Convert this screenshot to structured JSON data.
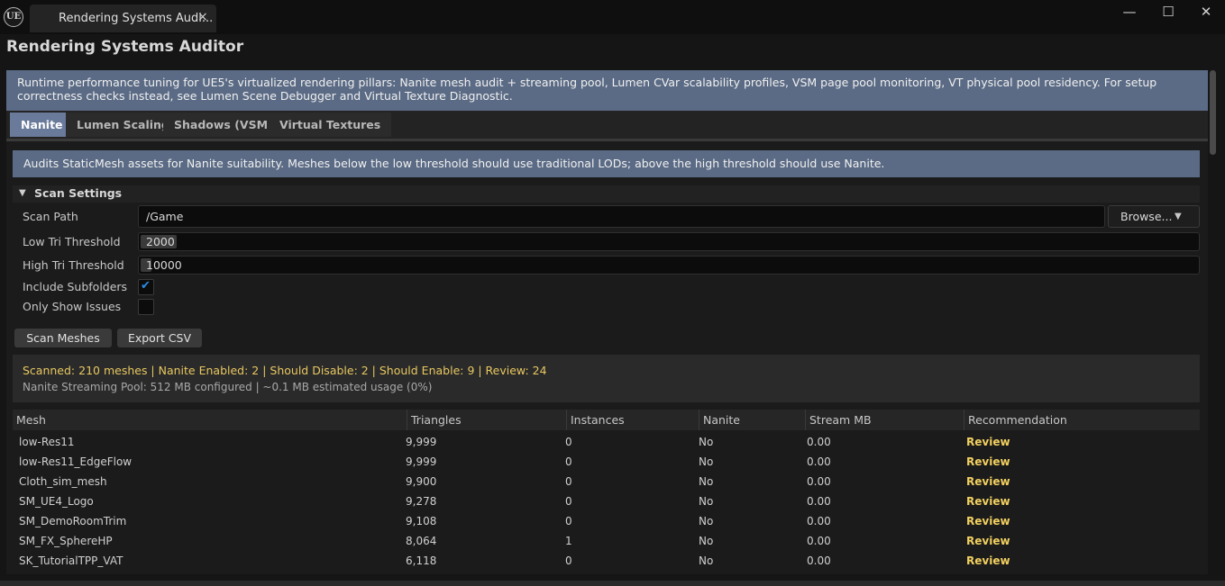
{
  "window": {
    "tab_title": "Rendering Systems Audi...",
    "logo_text": "UE",
    "close_tab_glyph": "×",
    "minimize_glyph": "—",
    "maximize_glyph": "☐",
    "close_glyph": "✕"
  },
  "app_title": "Rendering Systems Auditor",
  "intro_text": "Runtime performance tuning for UE5's virtualized rendering pillars: Nanite mesh audit + streaming pool, Lumen CVar scalability profiles, VSM page pool monitoring, VT physical pool residency. For setup correctness checks instead, see Lumen Scene Debugger and Virtual Texture Diagnostic.",
  "tabs": [
    {
      "label": "Nanite",
      "active": true
    },
    {
      "label": "Lumen Scaling",
      "active": false
    },
    {
      "label": "Shadows (VSM)",
      "active": false
    },
    {
      "label": "Virtual Textures",
      "active": false
    }
  ],
  "section_description": "Audits StaticMesh assets for Nanite suitability. Meshes below the low threshold should use traditional LODs; above the high threshold should use Nanite.",
  "scan_settings": {
    "title": "Scan Settings",
    "scan_path_label": "Scan Path",
    "scan_path_value": "/Game",
    "browse_label": "Browse...",
    "low_tri_label": "Low Tri Threshold",
    "low_tri_value": "2000",
    "high_tri_label": "High Tri Threshold",
    "high_tri_value": "10000",
    "include_subfolders_label": "Include Subfolders",
    "include_subfolders_checked": true,
    "only_issues_label": "Only Show Issues",
    "only_issues_checked": false
  },
  "actions": {
    "scan_label": "Scan Meshes",
    "export_label": "Export CSV"
  },
  "summary": {
    "line1": "Scanned: 210 meshes  |  Nanite Enabled: 2  |  Should Disable: 2  |  Should Enable: 9  |  Review: 24",
    "line2": "Nanite Streaming Pool: 512 MB configured  |  ~0.1 MB estimated usage (0%)"
  },
  "table": {
    "columns": [
      "Mesh",
      "Triangles",
      "Instances",
      "Nanite",
      "Stream MB",
      "Recommendation"
    ],
    "rows": [
      [
        "low-Res11",
        "9,999",
        "0",
        "No",
        "0.00",
        "Review"
      ],
      [
        "low-Res11_EdgeFlow",
        "9,999",
        "0",
        "No",
        "0.00",
        "Review"
      ],
      [
        "Cloth_sim_mesh",
        "9,900",
        "0",
        "No",
        "0.00",
        "Review"
      ],
      [
        "SM_UE4_Logo",
        "9,278",
        "0",
        "No",
        "0.00",
        "Review"
      ],
      [
        "SM_DemoRoomTrim",
        "9,108",
        "0",
        "No",
        "0.00",
        "Review"
      ],
      [
        "SM_FX_SphereHP",
        "8,064",
        "1",
        "No",
        "0.00",
        "Review"
      ],
      [
        "SK_TutorialTPP_VAT",
        "6,118",
        "0",
        "No",
        "0.00",
        "Review"
      ]
    ]
  },
  "colors": {
    "banner": "#5b6b85",
    "active_tab": "#6a7a9a",
    "summary_highlight": "#e8c860",
    "recommendation": "#f2d060",
    "checkbox_accent": "#2a8be6"
  }
}
